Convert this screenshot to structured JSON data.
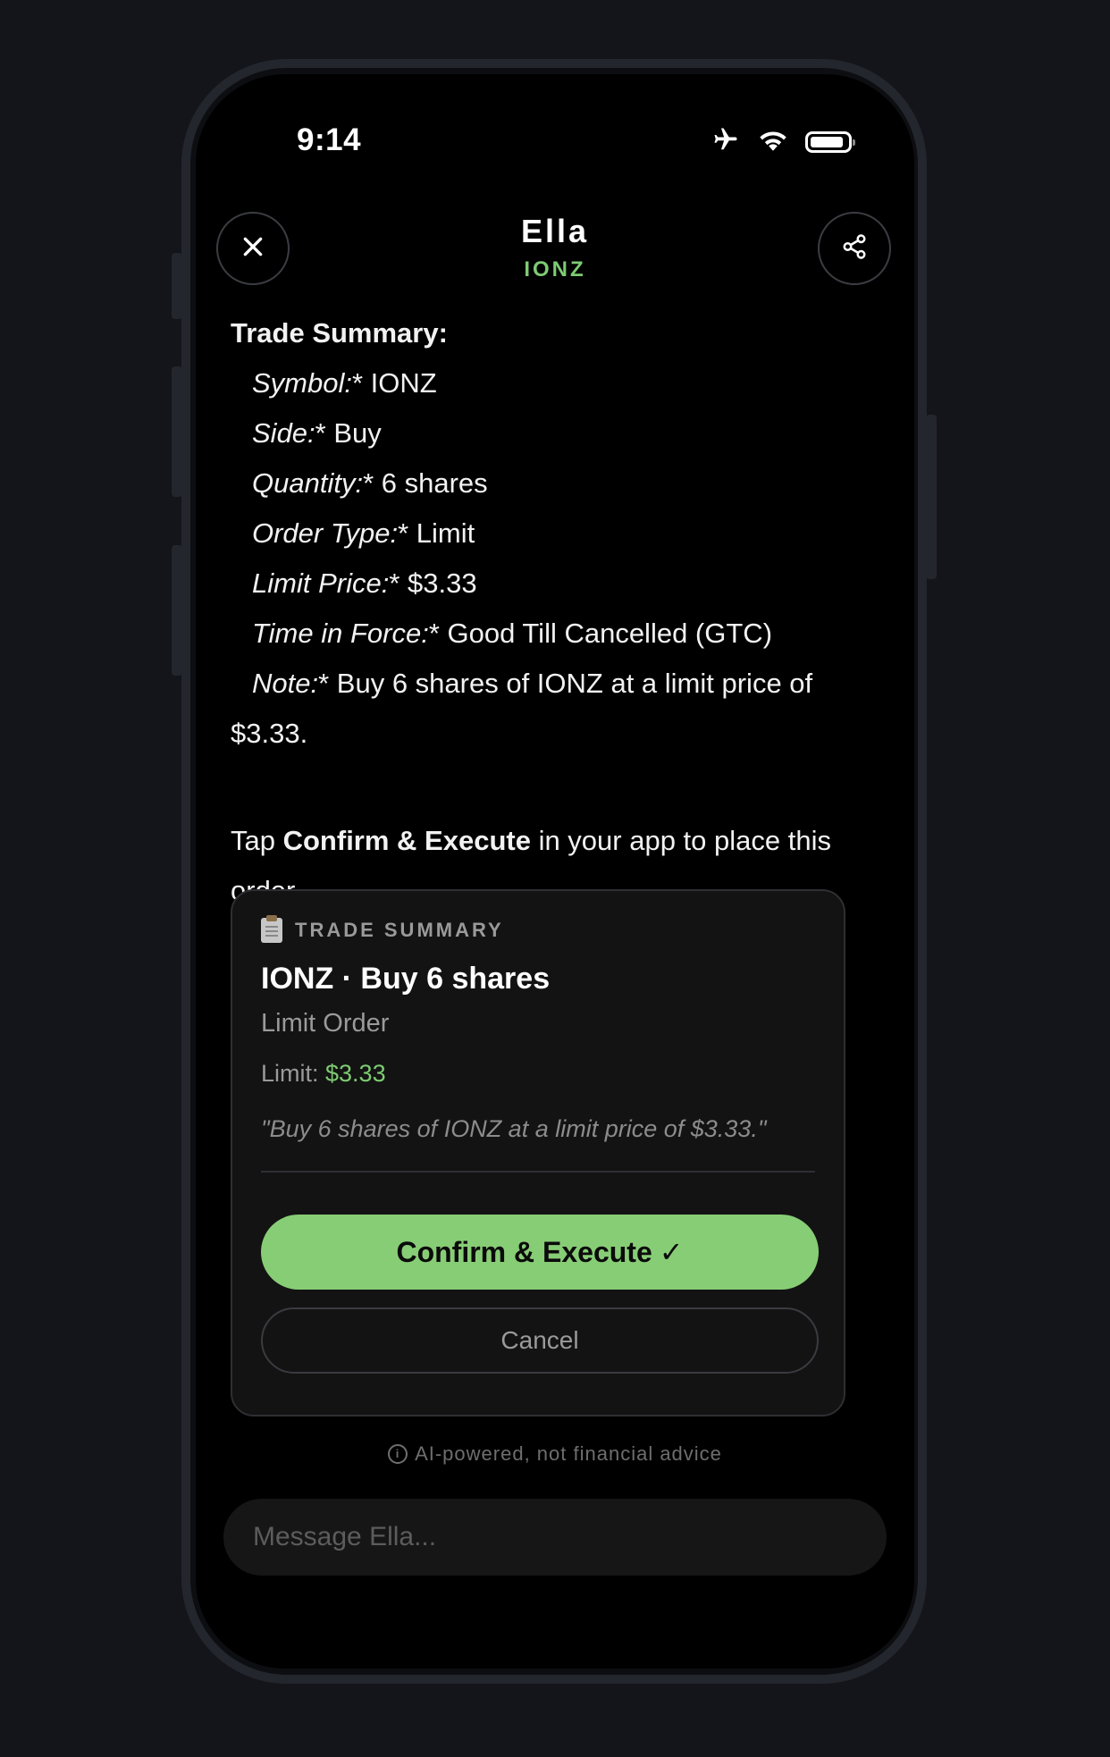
{
  "status_bar": {
    "time": "9:14",
    "icons": [
      "airplane-icon",
      "wifi-icon",
      "battery-icon"
    ]
  },
  "header": {
    "title": "Ella",
    "subtitle": "IONZ",
    "close_icon": "close-icon",
    "share_icon": "share-icon"
  },
  "message": {
    "heading": "Trade Summary:",
    "lines": [
      {
        "label": "Symbol:",
        "value": "* IONZ"
      },
      {
        "label": "Side:",
        "value": "* Buy"
      },
      {
        "label": "Quantity:",
        "value": "* 6 shares"
      },
      {
        "label": "Order Type:",
        "value": "* Limit"
      },
      {
        "label": "Limit Price:",
        "value": "* $3.33"
      },
      {
        "label": "Time in Force:",
        "value": "* Good Till Cancelled (GTC)"
      },
      {
        "label": "Note:",
        "value": "* Buy 6 shares of IONZ at a limit price of $3.33."
      }
    ],
    "cta_prefix": "Tap ",
    "cta_bold": "Confirm & Execute",
    "cta_suffix": " in your app to place this order."
  },
  "card": {
    "eyebrow": "TRADE SUMMARY",
    "title": "IONZ · Buy 6 shares",
    "subtitle": "Limit Order",
    "limit_label": "Limit: ",
    "limit_value": "$3.33",
    "quote": "\"Buy 6 shares of IONZ at a limit price of $3.33.\"",
    "confirm_label": "Confirm & Execute",
    "confirm_check": "✓",
    "cancel_label": "Cancel"
  },
  "disclaimer": "AI-powered, not financial advice",
  "composer": {
    "placeholder": "Message Ella..."
  },
  "colors": {
    "accent_green": "#7dcb72",
    "button_green": "#87cd75",
    "background": "#000000"
  }
}
